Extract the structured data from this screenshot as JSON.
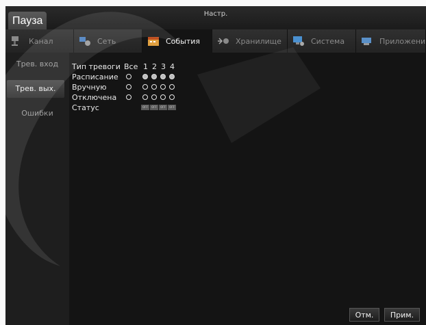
{
  "window": {
    "title": "Настр.",
    "pause_label": "Пауза"
  },
  "tabs": [
    {
      "label": "Канал",
      "icon": "camera-icon",
      "active": false
    },
    {
      "label": "Сеть",
      "icon": "network-icon",
      "active": false
    },
    {
      "label": "События",
      "icon": "calendar-icon",
      "active": true
    },
    {
      "label": "Хранилище",
      "icon": "storage-icon",
      "active": false
    },
    {
      "label": "Система",
      "icon": "computer-icon",
      "active": false
    },
    {
      "label": "Приложения",
      "icon": "apps-icon",
      "active": false
    }
  ],
  "sidebar": {
    "items": [
      {
        "label": "Трев. вход",
        "active": false
      },
      {
        "label": "Трев. вых.",
        "active": true
      },
      {
        "label": "Ошибки",
        "active": false
      }
    ]
  },
  "alarm_table": {
    "header_label": "Тип тревоги",
    "all_label": "Все",
    "channels": [
      "1",
      "2",
      "3",
      "4"
    ],
    "rows": [
      {
        "label": "Расписание",
        "all_selected": false,
        "selected": [
          true,
          true,
          true,
          true
        ]
      },
      {
        "label": "Вручную",
        "all_selected": false,
        "selected": [
          false,
          false,
          false,
          false
        ]
      },
      {
        "label": "Отключена",
        "all_selected": false,
        "selected": [
          false,
          false,
          false,
          false
        ]
      }
    ],
    "status_label": "Статус",
    "status_values": [
      "OFF",
      "OFF",
      "OFF",
      "OFF"
    ]
  },
  "buttons": {
    "cancel": "Отм.",
    "apply": "Прим."
  },
  "colors": {
    "background": "#141414",
    "sidebar": "#1e1e1e",
    "selected_radio": "#bdbdbd"
  }
}
